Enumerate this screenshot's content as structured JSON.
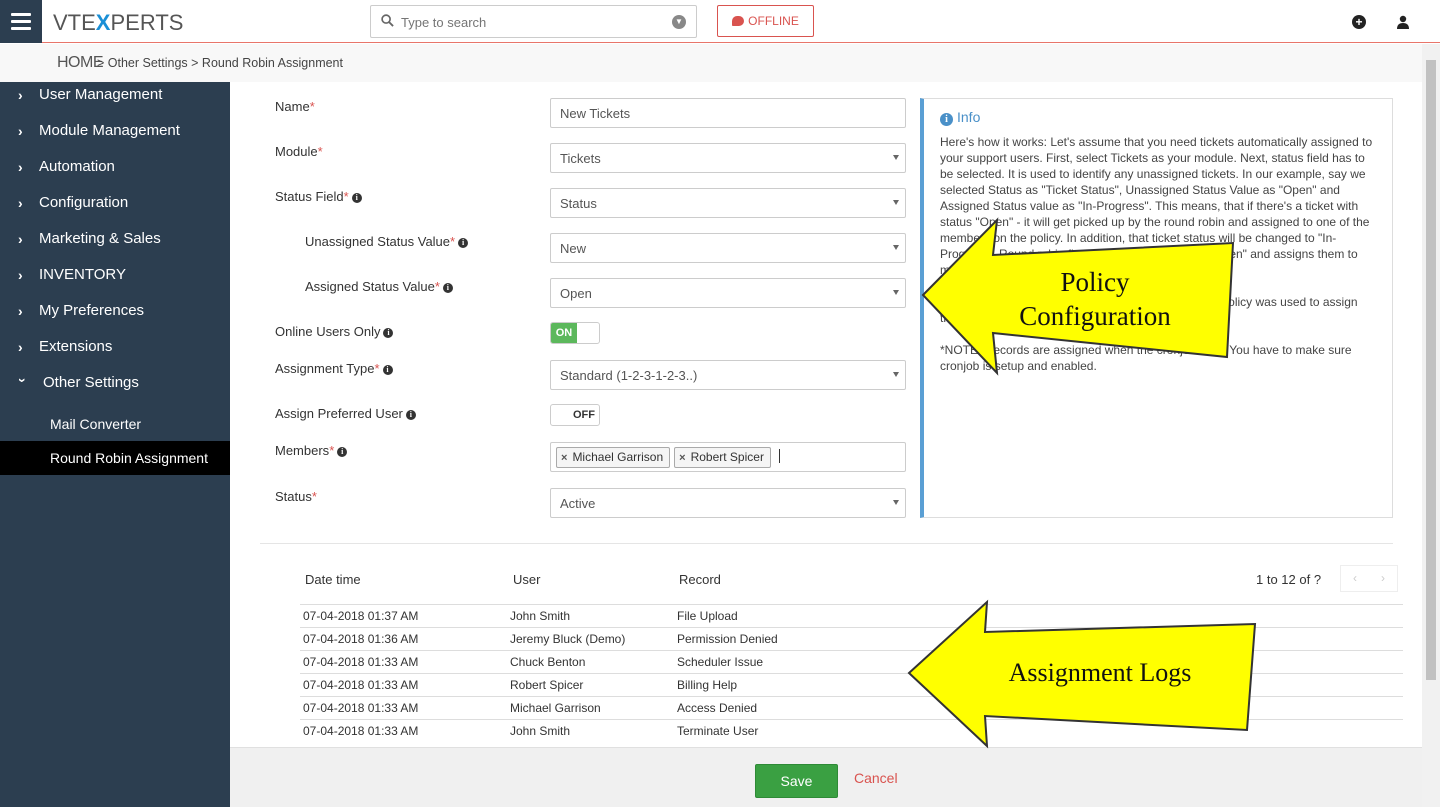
{
  "header": {
    "logo_left": "VTE",
    "logo_x": "X",
    "logo_right": "PERTS",
    "search_placeholder": "Type to search",
    "offline_label": "OFFLINE"
  },
  "breadcrumb": {
    "home": "HOME",
    "trail": "> Other Settings >  Round Robin Assignment"
  },
  "sidebar": {
    "items": [
      {
        "label": "User Management"
      },
      {
        "label": "Module Management"
      },
      {
        "label": "Automation"
      },
      {
        "label": "Configuration"
      },
      {
        "label": "Marketing & Sales"
      },
      {
        "label": "INVENTORY"
      },
      {
        "label": "My Preferences"
      },
      {
        "label": "Extensions"
      },
      {
        "label": "Other Settings"
      }
    ],
    "subitems": [
      {
        "label": "Mail Converter"
      },
      {
        "label": "Round Robin Assignment"
      }
    ]
  },
  "form": {
    "name_label": "Name",
    "name_value": "New Tickets",
    "module_label": "Module",
    "module_value": "Tickets",
    "status_field_label": "Status Field",
    "status_field_value": "Status",
    "unassigned_label": "Unassigned Status Value",
    "unassigned_value": "New",
    "assigned_label": "Assigned Status Value",
    "assigned_value": "Open",
    "online_users_label": "Online Users Only",
    "online_users_toggle": "ON",
    "assignment_type_label": "Assignment Type",
    "assignment_type_value": "Standard (1-2-3-1-2-3..)",
    "preferred_user_label": "Assign Preferred User",
    "preferred_user_toggle": "OFF",
    "members_label": "Members",
    "members": [
      "Michael Garrison",
      "Robert Spicer"
    ],
    "status_label": "Status",
    "status_value": "Active",
    "required_mark": "*"
  },
  "info": {
    "title": "Info",
    "para1": "Here's how it works: Let's assume that you need tickets automatically assigned to your support users. First, select Tickets as your module. Next, status field has to be selected. It is used to identify any unassigned tickets. In our example, say we selected Status as \"Ticket Status\", Unassigned Status Value as \"Open\" and Assigned Status value as \"In-Progress\". This means, that if there's a ticket with status \"Open\" - it will get picked up by the round robin and assigned to one of the members on the policy. In addition, that ticket status will be changed to \"In-Progress\". Round robin finds all tickets with status \"Open\" and assigns them to members (and changes status).",
    "para2": "This field is not editable and it is used to show which policy was used to assign the record.",
    "para3": "*NOTE: Records are assigned when the cronjob runs. You have to make sure cronjob is setup and enabled."
  },
  "logs": {
    "headers": {
      "datetime": "Date time",
      "user": "User",
      "record": "Record"
    },
    "pager": "1 to 12  of ?",
    "pager_prev": "‹",
    "pager_next": "›",
    "rows": [
      {
        "datetime": "07-04-2018 01:37 AM",
        "user": "John Smith",
        "record": "File Upload"
      },
      {
        "datetime": "07-04-2018 01:36 AM",
        "user": "Jeremy Bluck (Demo)",
        "record": "Permission Denied"
      },
      {
        "datetime": "07-04-2018 01:33 AM",
        "user": "Chuck Benton",
        "record": "Scheduler Issue"
      },
      {
        "datetime": "07-04-2018 01:33 AM",
        "user": "Robert Spicer",
        "record": "Billing Help"
      },
      {
        "datetime": "07-04-2018 01:33 AM",
        "user": "Michael Garrison",
        "record": "Access Denied"
      },
      {
        "datetime": "07-04-2018 01:33 AM",
        "user": "John Smith",
        "record": "Terminate User"
      }
    ]
  },
  "footer": {
    "save_label": "Save",
    "cancel_label": "Cancel"
  },
  "annotations": {
    "policy_line1": "Policy",
    "policy_line2": "Configuration",
    "logs_label": "Assignment Logs",
    "arrow_color": "#ffff00"
  }
}
